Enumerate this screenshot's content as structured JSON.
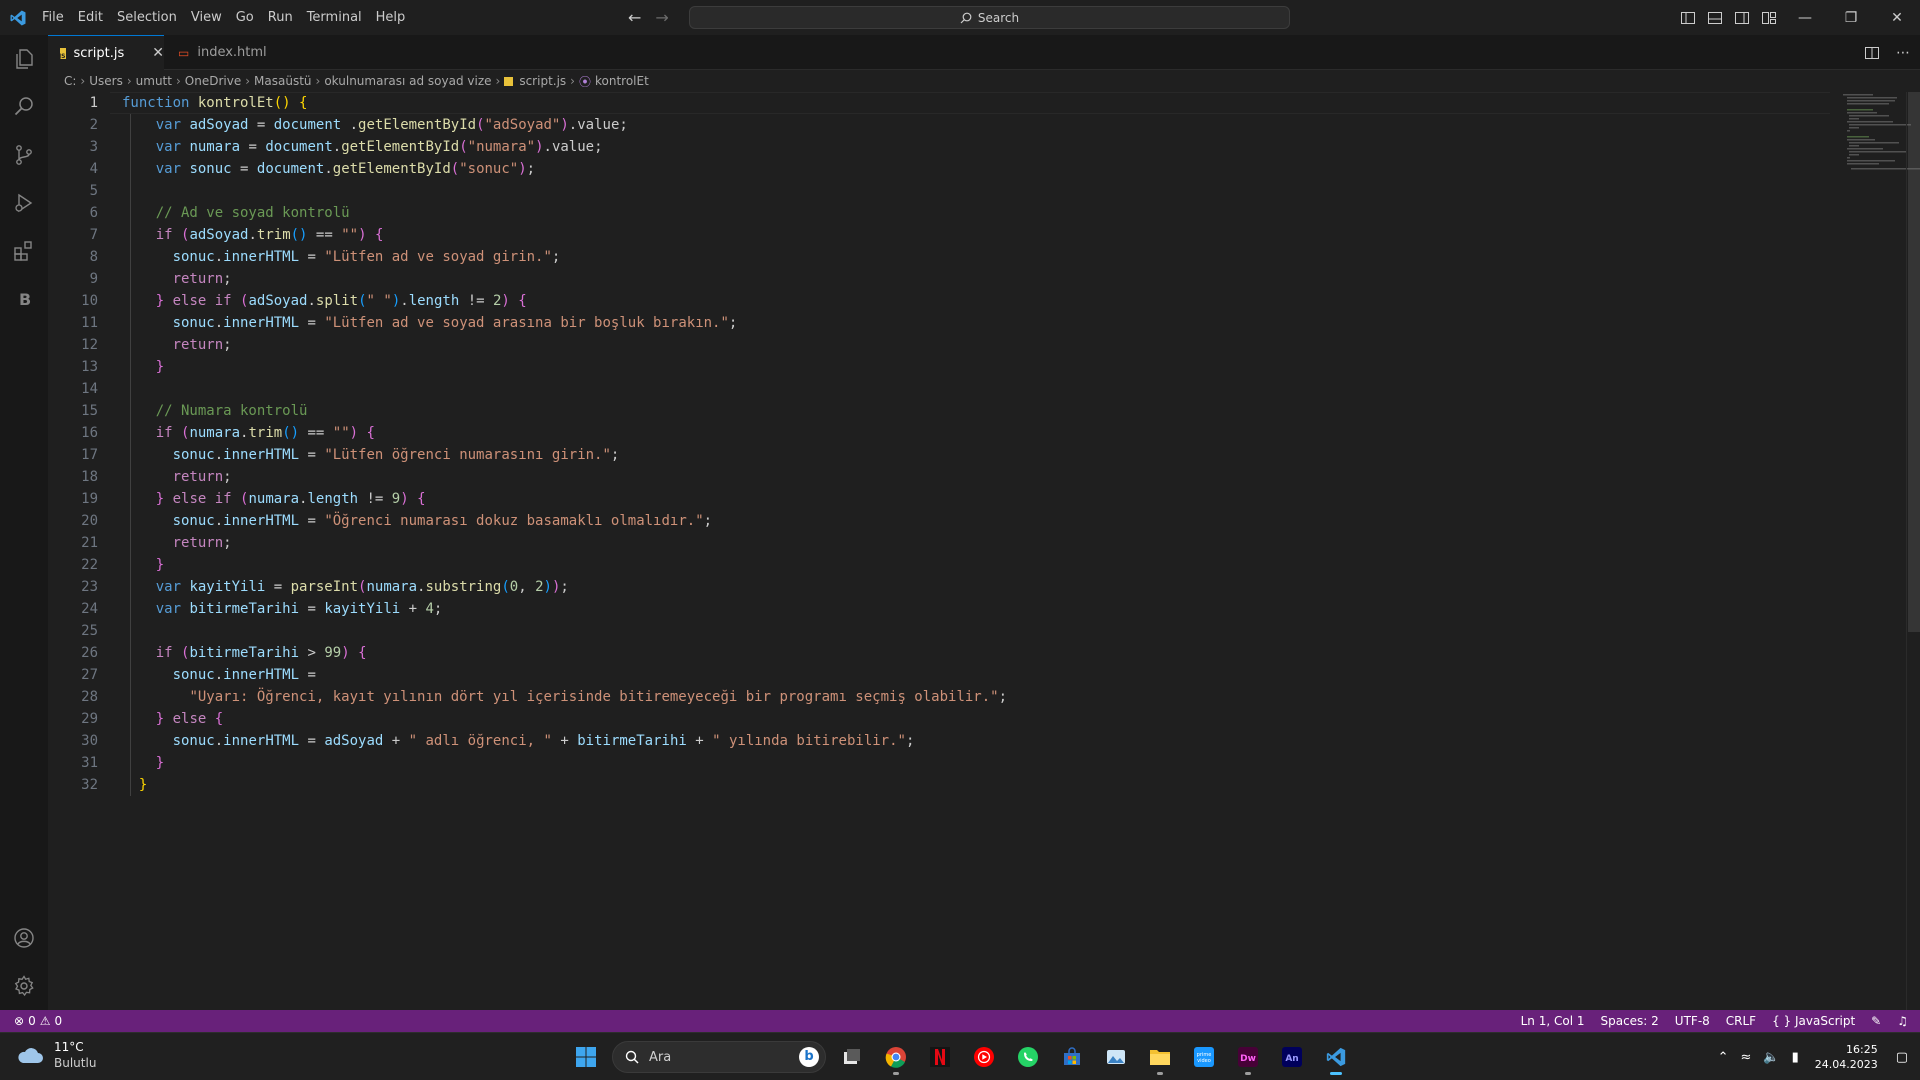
{
  "menu": [
    "File",
    "Edit",
    "Selection",
    "View",
    "Go",
    "Run",
    "Terminal",
    "Help"
  ],
  "search": {
    "label": "Search"
  },
  "tabs": [
    {
      "label": "script.js",
      "active": true
    },
    {
      "label": "index.html",
      "active": false
    }
  ],
  "breadcrumb": {
    "path": [
      "C:",
      "Users",
      "umutt",
      "OneDrive",
      "Masaüstü",
      "okulnumarası ad soyad vize"
    ],
    "file": "script.js",
    "symbol": "kontrolEt"
  },
  "editor": {
    "current_line": 1,
    "lines": [
      [
        [
          "kw",
          "function "
        ],
        [
          "fn",
          "kontrolEt"
        ],
        [
          "br1",
          "() {"
        ]
      ],
      [
        [
          "",
          "    "
        ],
        [
          "kw",
          "var "
        ],
        [
          "vr",
          "adSoyad"
        ],
        [
          "",
          " = "
        ],
        [
          "vr",
          "document"
        ],
        [
          "",
          " ."
        ],
        [
          "fn",
          "getElementById"
        ],
        [
          "br2",
          "("
        ],
        [
          "st",
          "\"adSoyad\""
        ],
        [
          "br2",
          ")"
        ],
        [
          "",
          ".value;"
        ]
      ],
      [
        [
          "",
          "    "
        ],
        [
          "kw",
          "var "
        ],
        [
          "vr",
          "numara"
        ],
        [
          "",
          " = "
        ],
        [
          "vr",
          "document"
        ],
        [
          "",
          "."
        ],
        [
          "fn",
          "getElementById"
        ],
        [
          "br2",
          "("
        ],
        [
          "st",
          "\"numara\""
        ],
        [
          "br2",
          ")"
        ],
        [
          "",
          ".value;"
        ]
      ],
      [
        [
          "",
          "    "
        ],
        [
          "kw",
          "var "
        ],
        [
          "vr",
          "sonuc"
        ],
        [
          "",
          " = "
        ],
        [
          "vr",
          "document"
        ],
        [
          "",
          "."
        ],
        [
          "fn",
          "getElementById"
        ],
        [
          "br2",
          "("
        ],
        [
          "st",
          "\"sonuc\""
        ],
        [
          "br2",
          ")"
        ],
        [
          "",
          ";"
        ]
      ],
      [],
      [
        [
          "",
          "    "
        ],
        [
          "cm",
          "// Ad ve soyad kontrolü"
        ]
      ],
      [
        [
          "",
          "    "
        ],
        [
          "ctl",
          "if "
        ],
        [
          "br2",
          "("
        ],
        [
          "vr",
          "adSoyad"
        ],
        [
          "",
          "."
        ],
        [
          "fn",
          "trim"
        ],
        [
          "br3",
          "()"
        ],
        [
          "",
          " == "
        ],
        [
          "st",
          "\"\""
        ],
        [
          "br2",
          ")"
        ],
        [
          "",
          " "
        ],
        [
          "br2",
          "{"
        ]
      ],
      [
        [
          "",
          "      "
        ],
        [
          "vr",
          "sonuc"
        ],
        [
          "",
          "."
        ],
        [
          "vr",
          "innerHTML"
        ],
        [
          "",
          " = "
        ],
        [
          "st",
          "\"Lütfen ad ve soyad girin.\""
        ],
        [
          "",
          ";"
        ]
      ],
      [
        [
          "",
          "      "
        ],
        [
          "ctl",
          "return"
        ],
        [
          "",
          ";"
        ]
      ],
      [
        [
          "",
          "    "
        ],
        [
          "br2",
          "}"
        ],
        [
          "",
          " "
        ],
        [
          "ctl",
          "else if "
        ],
        [
          "br2",
          "("
        ],
        [
          "vr",
          "adSoyad"
        ],
        [
          "",
          "."
        ],
        [
          "fn",
          "split"
        ],
        [
          "br3",
          "("
        ],
        [
          "st",
          "\" \""
        ],
        [
          "br3",
          ")"
        ],
        [
          "",
          "."
        ],
        [
          "vr",
          "length"
        ],
        [
          "",
          " != "
        ],
        [
          "nu",
          "2"
        ],
        [
          "br2",
          ")"
        ],
        [
          "",
          " "
        ],
        [
          "br2",
          "{"
        ]
      ],
      [
        [
          "",
          "      "
        ],
        [
          "vr",
          "sonuc"
        ],
        [
          "",
          "."
        ],
        [
          "vr",
          "innerHTML"
        ],
        [
          "",
          " = "
        ],
        [
          "st",
          "\"Lütfen ad ve soyad arasına bir boşluk bırakın.\""
        ],
        [
          "",
          ";"
        ]
      ],
      [
        [
          "",
          "      "
        ],
        [
          "ctl",
          "return"
        ],
        [
          "",
          ";"
        ]
      ],
      [
        [
          "",
          "    "
        ],
        [
          "br2",
          "}"
        ]
      ],
      [],
      [
        [
          "",
          "    "
        ],
        [
          "cm",
          "// Numara kontrolü"
        ]
      ],
      [
        [
          "",
          "    "
        ],
        [
          "ctl",
          "if "
        ],
        [
          "br2",
          "("
        ],
        [
          "vr",
          "numara"
        ],
        [
          "",
          "."
        ],
        [
          "fn",
          "trim"
        ],
        [
          "br3",
          "()"
        ],
        [
          "",
          " == "
        ],
        [
          "st",
          "\"\""
        ],
        [
          "br2",
          ")"
        ],
        [
          "",
          " "
        ],
        [
          "br2",
          "{"
        ]
      ],
      [
        [
          "",
          "      "
        ],
        [
          "vr",
          "sonuc"
        ],
        [
          "",
          "."
        ],
        [
          "vr",
          "innerHTML"
        ],
        [
          "",
          " = "
        ],
        [
          "st",
          "\"Lütfen öğrenci numarasını girin.\""
        ],
        [
          "",
          ";"
        ]
      ],
      [
        [
          "",
          "      "
        ],
        [
          "ctl",
          "return"
        ],
        [
          "",
          ";"
        ]
      ],
      [
        [
          "",
          "    "
        ],
        [
          "br2",
          "}"
        ],
        [
          "",
          " "
        ],
        [
          "ctl",
          "else if "
        ],
        [
          "br2",
          "("
        ],
        [
          "vr",
          "numara"
        ],
        [
          "",
          "."
        ],
        [
          "vr",
          "length"
        ],
        [
          "",
          " != "
        ],
        [
          "nu",
          "9"
        ],
        [
          "br2",
          ")"
        ],
        [
          "",
          " "
        ],
        [
          "br2",
          "{"
        ]
      ],
      [
        [
          "",
          "      "
        ],
        [
          "vr",
          "sonuc"
        ],
        [
          "",
          "."
        ],
        [
          "vr",
          "innerHTML"
        ],
        [
          "",
          " = "
        ],
        [
          "st",
          "\"Öğrenci numarası dokuz basamaklı olmalıdır.\""
        ],
        [
          "",
          ";"
        ]
      ],
      [
        [
          "",
          "      "
        ],
        [
          "ctl",
          "return"
        ],
        [
          "",
          ";"
        ]
      ],
      [
        [
          "",
          "    "
        ],
        [
          "br2",
          "}"
        ]
      ],
      [
        [
          "",
          "    "
        ],
        [
          "kw",
          "var "
        ],
        [
          "vr",
          "kayitYili"
        ],
        [
          "",
          " = "
        ],
        [
          "fn",
          "parseInt"
        ],
        [
          "br2",
          "("
        ],
        [
          "vr",
          "numara"
        ],
        [
          "",
          "."
        ],
        [
          "fn",
          "substring"
        ],
        [
          "br3",
          "("
        ],
        [
          "nu",
          "0"
        ],
        [
          "",
          ", "
        ],
        [
          "nu",
          "2"
        ],
        [
          "br3",
          ")"
        ],
        [
          "br2",
          ")"
        ],
        [
          "",
          ";"
        ]
      ],
      [
        [
          "",
          "    "
        ],
        [
          "kw",
          "var "
        ],
        [
          "vr",
          "bitirmeTarihi"
        ],
        [
          "",
          " = "
        ],
        [
          "vr",
          "kayitYili"
        ],
        [
          "",
          " + "
        ],
        [
          "nu",
          "4"
        ],
        [
          "",
          ";"
        ]
      ],
      [],
      [
        [
          "",
          "    "
        ],
        [
          "ctl",
          "if "
        ],
        [
          "br2",
          "("
        ],
        [
          "vr",
          "bitirmeTarihi"
        ],
        [
          "",
          " > "
        ],
        [
          "nu",
          "99"
        ],
        [
          "br2",
          ")"
        ],
        [
          "",
          " "
        ],
        [
          "br2",
          "{"
        ]
      ],
      [
        [
          "",
          "      "
        ],
        [
          "vr",
          "sonuc"
        ],
        [
          "",
          "."
        ],
        [
          "vr",
          "innerHTML"
        ],
        [
          "",
          " ="
        ]
      ],
      [
        [
          "",
          "        "
        ],
        [
          "st",
          "\"Uyarı: Öğrenci, kayıt yılının dört yıl içerisinde bitiremeyeceği bir programı seçmiş olabilir.\""
        ],
        [
          "",
          ";"
        ]
      ],
      [
        [
          "",
          "    "
        ],
        [
          "br2",
          "}"
        ],
        [
          "",
          " "
        ],
        [
          "ctl",
          "else "
        ],
        [
          "br2",
          "{"
        ]
      ],
      [
        [
          "",
          "      "
        ],
        [
          "vr",
          "sonuc"
        ],
        [
          "",
          "."
        ],
        [
          "vr",
          "innerHTML"
        ],
        [
          "",
          " = "
        ],
        [
          "vr",
          "adSoyad"
        ],
        [
          "",
          " + "
        ],
        [
          "st",
          "\" adlı öğrenci, \""
        ],
        [
          "",
          " + "
        ],
        [
          "vr",
          "bitirmeTarihi"
        ],
        [
          "",
          " + "
        ],
        [
          "st",
          "\" yılında bitirebilir.\""
        ],
        [
          "",
          ";"
        ]
      ],
      [
        [
          "",
          "    "
        ],
        [
          "br2",
          "}"
        ]
      ],
      [
        [
          "",
          "  "
        ],
        [
          "br1",
          "}"
        ]
      ]
    ]
  },
  "statusbar": {
    "errors": "0",
    "warnings": "0",
    "position": "Ln 1, Col 1",
    "spaces": "Spaces: 2",
    "encoding": "UTF-8",
    "eol": "CRLF",
    "language": "JavaScript",
    "color": "#68217a"
  },
  "taskbar": {
    "weather_temp": "11°C",
    "weather_desc": "Bulutlu",
    "search_placeholder": "Ara",
    "time": "16:25",
    "date": "24.04.2023"
  }
}
